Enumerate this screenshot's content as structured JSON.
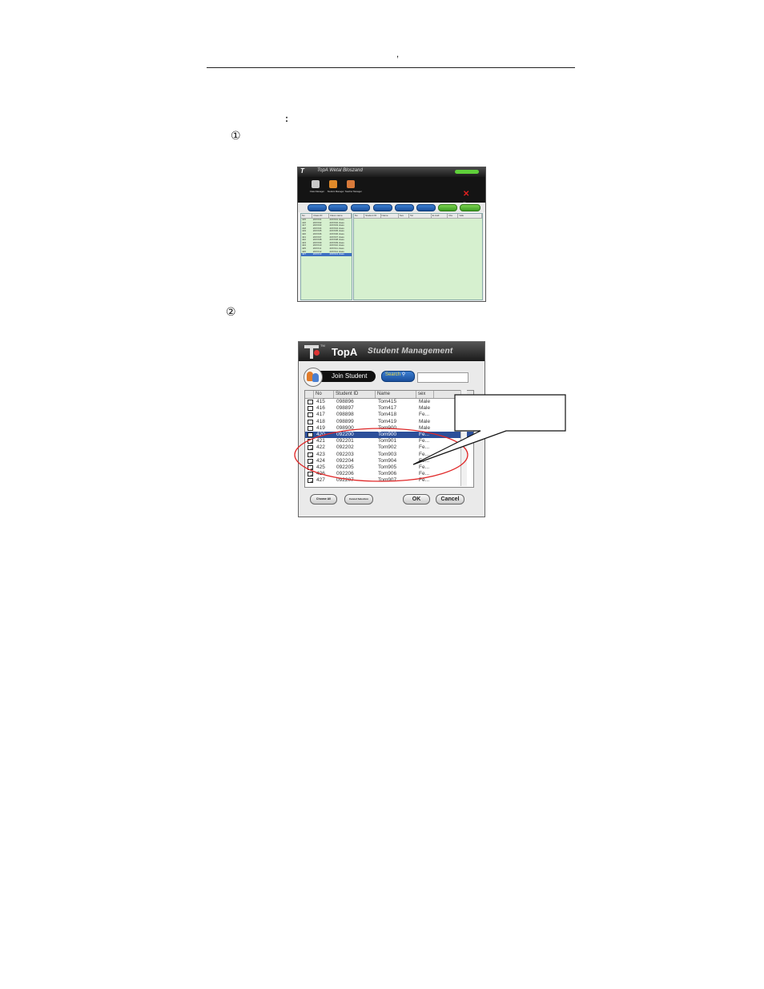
{
  "header": {
    "mark": ","
  },
  "intro": {
    "colon": ":"
  },
  "steps": {
    "step1": "①",
    "step2": "②"
  },
  "screenshot1": {
    "logo": "T",
    "title": "TopA Wetal Bloszand",
    "toolbar_icons": [
      {
        "label": "Class Manager"
      },
      {
        "label": "Student Manager"
      },
      {
        "label": "Teacher Manager"
      }
    ],
    "close_label": "Close",
    "left_headers": [
      "No",
      "Class ID",
      "Class name"
    ],
    "left_rows": [
      [
        "415",
        "20XX01",
        "20XX01 class"
      ],
      [
        "416",
        "20XX02",
        "20XX02 class"
      ],
      [
        "417",
        "20XX03",
        "20XX03 class"
      ],
      [
        "418",
        "20XX04",
        "20XX04 class"
      ],
      [
        "419",
        "20XX05",
        "20XX05 class"
      ],
      [
        "420",
        "20XX06",
        "20XX06 class"
      ],
      [
        "421",
        "20XX07",
        "20XX07 class"
      ],
      [
        "422",
        "20XX08",
        "20XX08 class"
      ],
      [
        "423",
        "20XX09",
        "20XX09 class"
      ],
      [
        "424",
        "20XX10",
        "20XX10 class"
      ],
      [
        "425",
        "20XX11",
        "20XX11 class"
      ],
      [
        "426",
        "20XX12",
        "20XX12 class"
      ],
      [
        "427",
        "20XX13",
        "20XX13 class"
      ]
    ],
    "right_headers": [
      "No",
      "Student ID",
      "Name",
      "Sex",
      "Tel",
      "E-mail",
      "Cla",
      "Valu"
    ]
  },
  "screenshot2": {
    "tm": "TM",
    "brand": "TopA",
    "subtitle": "Student Management",
    "join_label": "Join Student",
    "search_label": "Search",
    "columns": [
      "No",
      "Student ID",
      "Name",
      "sex"
    ],
    "rows": [
      {
        "check": "",
        "no": "415",
        "id": "098896",
        "name": "Tom415",
        "sex": "Male"
      },
      {
        "check": "",
        "no": "416",
        "id": "098897",
        "name": "Tom417",
        "sex": "Male"
      },
      {
        "check": "",
        "no": "417",
        "id": "098898",
        "name": "Tom418",
        "sex": "Fe..."
      },
      {
        "check": "",
        "no": "418",
        "id": "098899",
        "name": "Tom419",
        "sex": "Male"
      },
      {
        "check": "",
        "no": "419",
        "id": "098900",
        "name": "Tom900",
        "sex": "Male"
      },
      {
        "check": "✓",
        "no": "420",
        "id": "092200",
        "name": "Tom900",
        "sex": "Fe...",
        "selected": true
      },
      {
        "check": "✓",
        "no": "421",
        "id": "092201",
        "name": "Tom901",
        "sex": "Fe..."
      },
      {
        "check": "✓",
        "no": "422",
        "id": "092202",
        "name": "Tom902",
        "sex": "Fe..."
      },
      {
        "check": "✓",
        "no": "423",
        "id": "092203",
        "name": "Tom903",
        "sex": "Fe..."
      },
      {
        "check": "✓",
        "no": "424",
        "id": "092204",
        "name": "Tom904",
        "sex": "Fe..."
      },
      {
        "check": "✓",
        "no": "425",
        "id": "092205",
        "name": "Tom905",
        "sex": "Fe..."
      },
      {
        "check": "✓",
        "no": "426",
        "id": "092206",
        "name": "Tom906",
        "sex": "Fe..."
      },
      {
        "check": "✓",
        "no": "427",
        "id": "092207",
        "name": "Tom907",
        "sex": "Fe..."
      }
    ],
    "buttons": {
      "choose_all": "Choose All",
      "cancel_selection": "Cancel Selection",
      "ok": "OK",
      "cancel": "Cancel"
    }
  },
  "colors": {
    "pane_green": "#d6f0cf",
    "selection_blue": "#2c4f9a",
    "highlight_red": "#e02828",
    "button_blue": "#1a4f9c"
  }
}
